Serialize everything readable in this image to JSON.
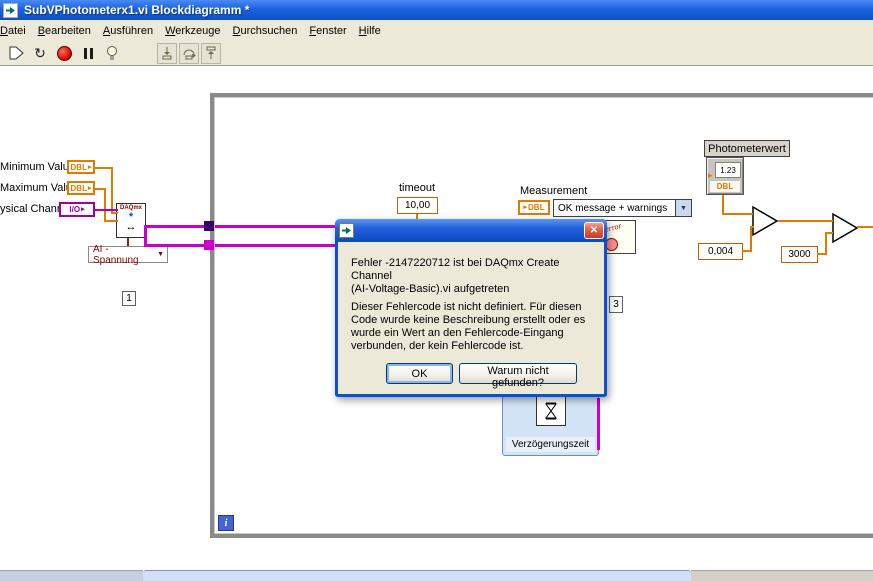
{
  "window": {
    "title": "SubVPhotometerx1.vi Blockdiagramm *"
  },
  "menu": {
    "items": [
      "Datei",
      "Bearbeiten",
      "Ausführen",
      "Werkzeuge",
      "Durchsuchen",
      "Fenster",
      "Hilfe"
    ]
  },
  "toolbar": {
    "icons": [
      "run",
      "run-continuous",
      "abort",
      "pause",
      "highlight-execution",
      "step-into",
      "step-over",
      "step-out"
    ]
  },
  "icons": {
    "dropdown": "▼",
    "close": "✕",
    "arrow_right": "▸",
    "run_continuous": "↻",
    "daq_star": "*",
    "daq_arrows": "↔"
  },
  "diagram": {
    "minimum_label": "Minimum Value",
    "maximum_label": "Maximum Value",
    "physical_channel_label": "ysical Channel",
    "dbl": "DBL",
    "io": "I/O",
    "daqmx_banner": "DAQmx",
    "ai_ring_value": "AI - Spannung",
    "const_one": "1",
    "timeout_label": "timeout",
    "timeout_value": "10,00",
    "measurement_label": "Measurement",
    "report_ring_value": "OK message + warnings",
    "error_icon_text": "error",
    "const_three": "3",
    "photometer_label": "Photometerwert",
    "photometer_display": "1.23",
    "const_threshold": "0,004",
    "const_wait": "3000",
    "delay_label": "Verzögerungszeit",
    "iterator": "i"
  },
  "dialog": {
    "error_text": "Fehler -2147220712 ist bei DAQmx Create Channel\n(AI-Voltage-Basic).vi aufgetreten",
    "description_text": "Dieser Fehlercode ist nicht definiert. Für diesen\nCode wurde keine Beschreibung erstellt oder es\nwurde ein Wert an den Fehlercode-Eingang\nverbunden, der kein Fehlercode ist.",
    "ok_button": "OK",
    "why_button": "Warum nicht gefunden?"
  },
  "colors": {
    "titlebar": "#1e63dd",
    "dbl_orange": "#e07c00",
    "magenta": "#cc00cc",
    "io_purple": "#a000a0",
    "loop_gray": "#8a8a8a",
    "dialog_frame": "#0a50cf",
    "xp_face": "#ece9d8"
  }
}
